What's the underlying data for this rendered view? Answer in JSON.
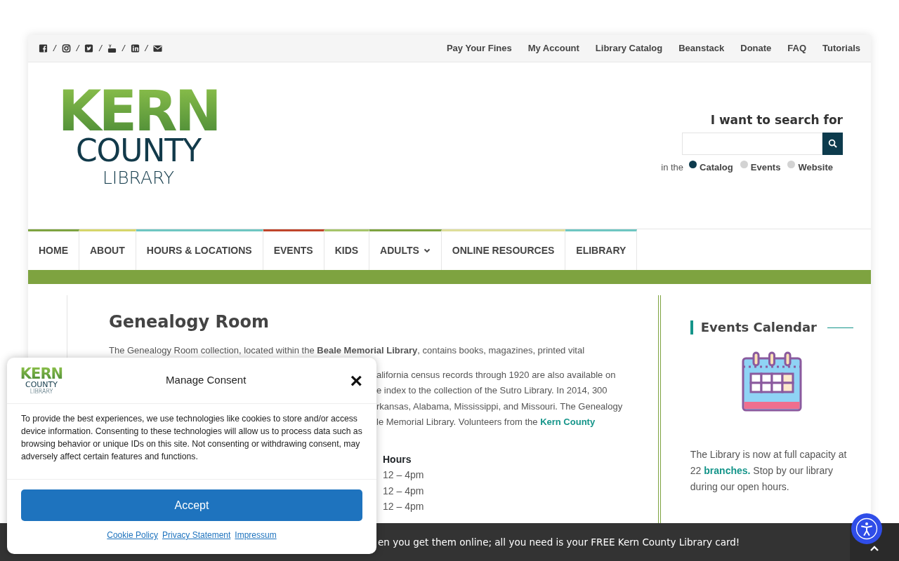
{
  "top_bar": {
    "social": [
      {
        "kind": "facebook"
      },
      {
        "kind": "instagram"
      },
      {
        "kind": "twitter"
      },
      {
        "kind": "youtube"
      },
      {
        "kind": "linkedin"
      },
      {
        "kind": "email"
      }
    ],
    "separator": "/",
    "links": [
      "Pay Your Fines",
      "My Account",
      "Library Catalog",
      "Beanstack",
      "Donate",
      "FAQ",
      "Tutorials"
    ]
  },
  "logo": {
    "line_1": "KERN",
    "line_2": "COUNTY",
    "line_3": "LIBRARY"
  },
  "search": {
    "heading": "I want to search for",
    "scope_label": "in the",
    "scopes": [
      {
        "label": "Catalog",
        "selected": true
      },
      {
        "label": "Events",
        "selected": false
      },
      {
        "label": "Website",
        "selected": false
      }
    ]
  },
  "nav": [
    {
      "label": "HOME",
      "color": "#7ea340",
      "dropdown": false
    },
    {
      "label": "ABOUT",
      "color": "#d6d66a",
      "dropdown": false
    },
    {
      "label": "HOURS & LOCATIONS",
      "color": "#6ec6c2",
      "dropdown": false
    },
    {
      "label": "EVENTS",
      "color": "#c0452b",
      "dropdown": false
    },
    {
      "label": "KIDS",
      "color": "#a6c46a",
      "dropdown": false
    },
    {
      "label": "ADULTS",
      "color": "#7ea340",
      "dropdown": true
    },
    {
      "label": "ONLINE RESOURCES",
      "color": "#dede9a",
      "dropdown": false
    },
    {
      "label": "ELIBRARY",
      "color": "#6ec6c2",
      "dropdown": false
    }
  ],
  "article": {
    "title": "Genealogy Room",
    "intro_line": "The Genealogy Room collection, located within the **Beale Memorial Library**, contains books, magazines, printed vital",
    "visible_fragments": [
      {
        "text": "alifornia census records through 1920 are also available on"
      },
      {
        "text": "e index to the collection of the Sutro Library. In 2014, 300"
      },
      {
        "text": "rkansas, Alabama, Mississippi, and Missouri. The Genealogy"
      },
      {
        "text": "le Memorial Library. Volunteers from the ",
        "link": "Kern County"
      }
    ],
    "hours_heading": "Hours",
    "hours": [
      "12 – 4pm",
      "12 – 4pm",
      "12 – 4pm"
    ]
  },
  "sidebar": {
    "title": "Events Calendar",
    "text_before": "The Library is now at full capacity at 22 ",
    "link": "branches.",
    "text_after": " Stop by our library during our open hours."
  },
  "notice_bar": {
    "text": "en you get them online; all you need is your FREE Kern County Library card!"
  },
  "consent": {
    "logo": {
      "line_1": "KERN",
      "line_2": "COUNTY",
      "line_3": "LIBRARY"
    },
    "title": "Manage Consent",
    "close": "×",
    "body": "To provide the best experiences, we use technologies like cookies to store and/or access device information. Consenting to these technologies will allow us to process data such as browsing behavior or unique IDs on this site. Not consenting or withdrawing consent, may adversely affect certain features and functions.",
    "accept": "Accept",
    "links": [
      "Cookie Policy",
      "Privacy Statement",
      "Impressum"
    ]
  }
}
